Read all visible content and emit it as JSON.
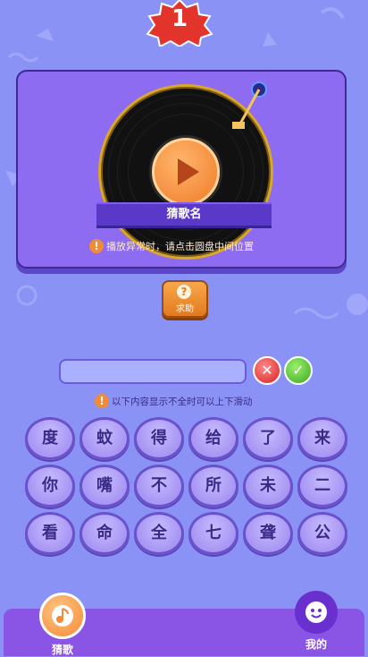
{
  "level": {
    "number": "1"
  },
  "player": {
    "song_title": "猜歌名",
    "hint": "播放异常时，请点击圆盘中间位置"
  },
  "help": {
    "label": "求助",
    "icon": "question-icon"
  },
  "answer": {
    "value": "",
    "clear_icon": "close-icon",
    "confirm_icon": "check-icon"
  },
  "scroll_hint": "以下内容显示不全时可以上下滑动",
  "characters": [
    [
      "度",
      "蚊",
      "得",
      "给",
      "了",
      "来"
    ],
    [
      "你",
      "嘴",
      "不",
      "所",
      "未",
      "二"
    ],
    [
      "看",
      "命",
      "全",
      "七",
      "聋",
      "公"
    ]
  ],
  "nav": {
    "guess_label": "猜歌",
    "mine_label": "我的"
  },
  "colors": {
    "background": "#8a92f6",
    "accent": "#f07a2a",
    "card": "#8d6cf2"
  }
}
